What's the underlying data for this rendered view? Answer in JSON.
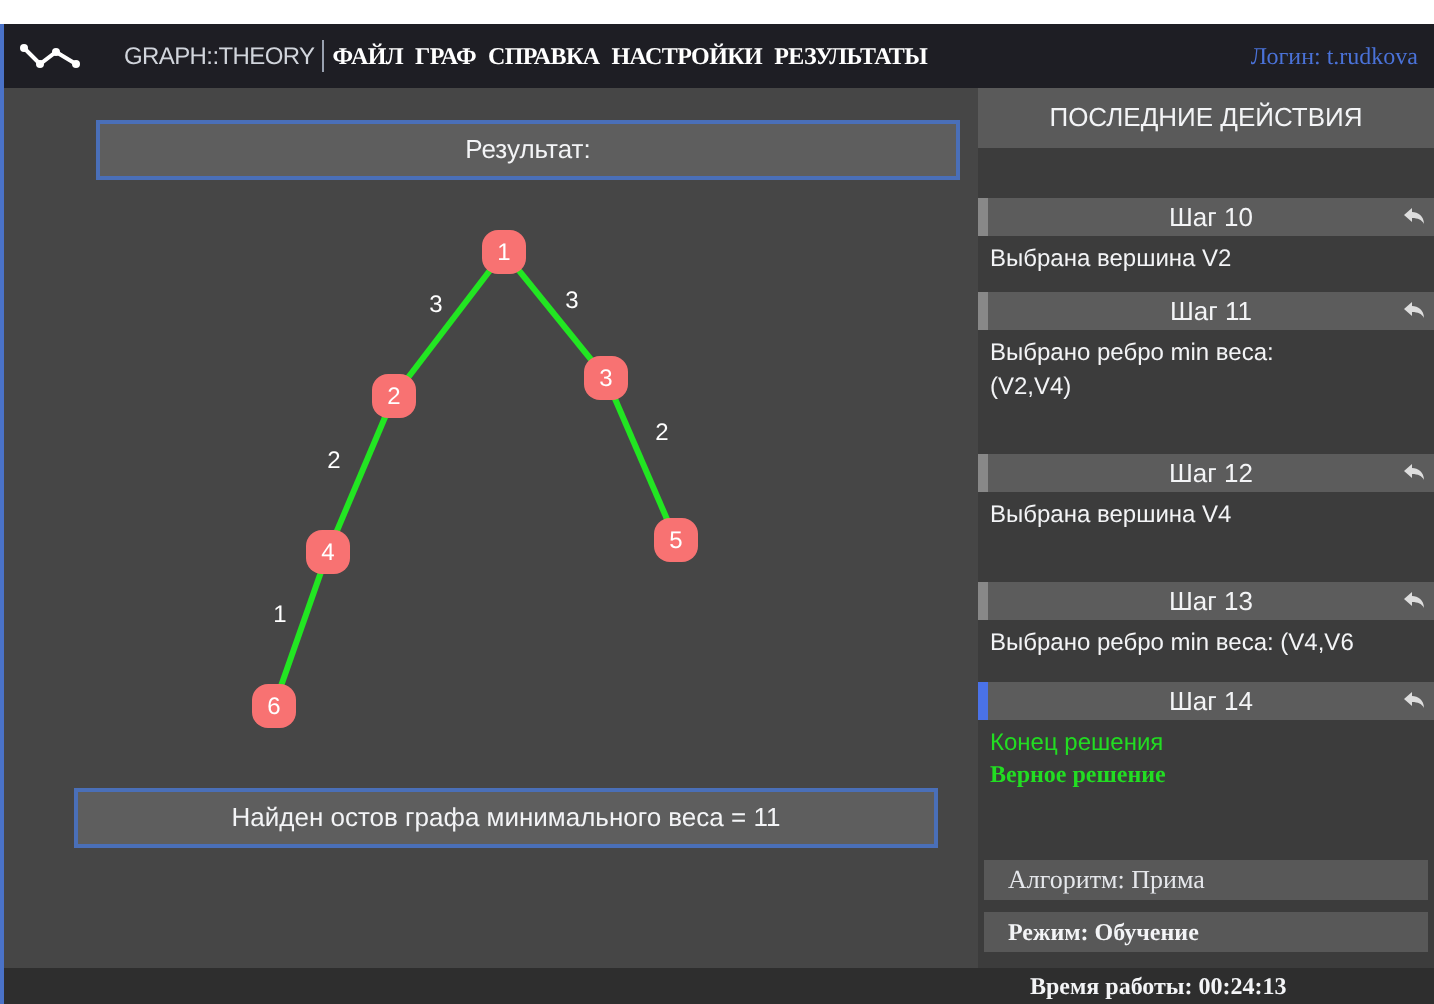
{
  "app": {
    "name": "GRAPH::THEORY"
  },
  "menu": [
    {
      "label": "ФАЙЛ"
    },
    {
      "label": "ГРАФ"
    },
    {
      "label": "СПРАВКА"
    },
    {
      "label": "НАСТРОЙКИ"
    },
    {
      "label": "РЕЗУЛЬТАТЫ"
    }
  ],
  "login": "Логин: t.rudkova",
  "result_header": "Результат:",
  "graph": {
    "nodes": [
      "1",
      "2",
      "3",
      "4",
      "5",
      "6"
    ],
    "edges": [
      {
        "weight": "3"
      },
      {
        "weight": "3"
      },
      {
        "weight": "2"
      },
      {
        "weight": "2"
      },
      {
        "weight": "1"
      }
    ]
  },
  "result_text": "Найден остов графа минимального веса = 11",
  "history": {
    "title": "ПОСЛЕДНИЕ ДЕЙСТВИЯ",
    "steps": [
      {
        "title": "Шаг 10",
        "selected": false,
        "lines": [
          {
            "text": "Выбрана вершина V2",
            "kind": "plain"
          }
        ]
      },
      {
        "title": "Шаг 11",
        "selected": false,
        "lines": [
          {
            "text": "Выбрано ребро min веса: (V2,V4)",
            "kind": "plain"
          }
        ]
      },
      {
        "title": "Шаг 12",
        "selected": false,
        "lines": [
          {
            "text": "Выбрана вершина V4",
            "kind": "plain"
          }
        ]
      },
      {
        "title": "Шаг 13",
        "selected": false,
        "lines": [
          {
            "text": "Выбрано ребро min веса: (V4,V6",
            "kind": "plain"
          }
        ]
      },
      {
        "title": "Шаг 14",
        "selected": true,
        "lines": [
          {
            "text": "Конец решения",
            "kind": "status"
          },
          {
            "text": "Верное решение",
            "kind": "verdict"
          }
        ]
      }
    ]
  },
  "algorithm": "Алгоритм: Прима",
  "mode": "Режим: Обучение",
  "elapsed": "Время работы: 00:24:13"
}
